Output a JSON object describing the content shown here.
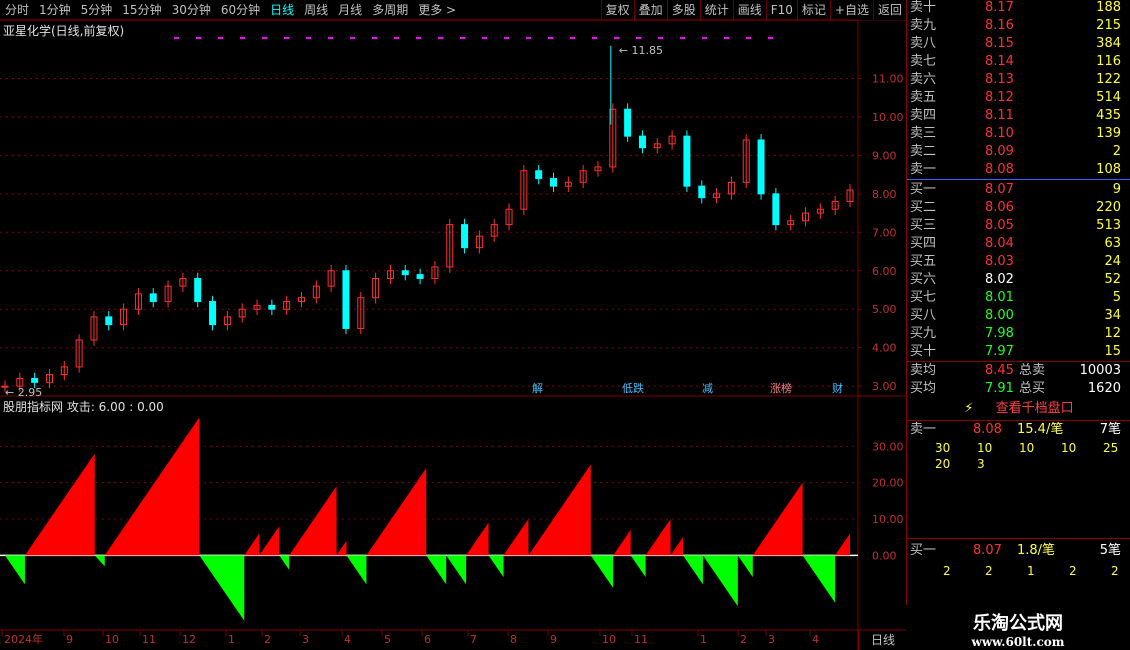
{
  "toolbar": {
    "periods": [
      "分时",
      "1分钟",
      "5分钟",
      "15分钟",
      "30分钟",
      "60分钟",
      "日线",
      "周线",
      "月线",
      "多周期",
      "更多 >"
    ],
    "active": "日线",
    "right": [
      "复权",
      "叠加",
      "多股",
      "统计",
      "画线",
      "F10",
      "标记",
      "+自选",
      "返回"
    ]
  },
  "main_title": "亚星化学(日线,前复权)",
  "sub_title": "股朋指标网  攻击: 6.00 : 0.00",
  "high_label": "11.85",
  "low_label": "2.95",
  "events": [
    "解",
    "低跌",
    "减",
    "涨榜",
    "财"
  ],
  "price_axis": [
    "11.00",
    "10.00",
    "9.00",
    "8.00",
    "7.00",
    "6.00",
    "5.00",
    "4.00",
    "3.00"
  ],
  "ind_axis": [
    "30.00",
    "20.00",
    "10.00",
    "0.00"
  ],
  "date_axis": [
    "2024年",
    "9",
    "10",
    "11",
    "12",
    "1",
    "2",
    "3",
    "4",
    "5",
    "6",
    "7",
    "8",
    "9",
    "10",
    "11",
    "1",
    "2",
    "3",
    "4"
  ],
  "period_label": "日线",
  "book": {
    "asks": [
      {
        "label": "卖十",
        "price": "8.17",
        "vol": "188"
      },
      {
        "label": "卖九",
        "price": "8.16",
        "vol": "215"
      },
      {
        "label": "卖八",
        "price": "8.15",
        "vol": "384"
      },
      {
        "label": "卖七",
        "price": "8.14",
        "vol": "116"
      },
      {
        "label": "卖六",
        "price": "8.13",
        "vol": "122"
      },
      {
        "label": "卖五",
        "price": "8.12",
        "vol": "514"
      },
      {
        "label": "卖四",
        "price": "8.11",
        "vol": "435"
      },
      {
        "label": "卖三",
        "price": "8.10",
        "vol": "139"
      },
      {
        "label": "卖二",
        "price": "8.09",
        "vol": "2"
      },
      {
        "label": "卖一",
        "price": "8.08",
        "vol": "108"
      }
    ],
    "bids": [
      {
        "label": "买一",
        "price": "8.07",
        "vol": "9"
      },
      {
        "label": "买二",
        "price": "8.06",
        "vol": "220"
      },
      {
        "label": "买三",
        "price": "8.05",
        "vol": "513"
      },
      {
        "label": "买四",
        "price": "8.04",
        "vol": "63"
      },
      {
        "label": "买五",
        "price": "8.03",
        "vol": "24"
      },
      {
        "label": "买六",
        "price": "8.02",
        "vol": "52"
      },
      {
        "label": "买七",
        "price": "8.01",
        "vol": "5"
      },
      {
        "label": "买八",
        "price": "8.00",
        "vol": "34"
      },
      {
        "label": "买九",
        "price": "7.98",
        "vol": "12"
      },
      {
        "label": "买十",
        "price": "7.97",
        "vol": "15"
      }
    ],
    "ask_avg_label": "卖均",
    "ask_avg": "8.45",
    "total_ask_label": "总卖",
    "total_ask": "10003",
    "bid_avg_label": "买均",
    "bid_avg": "7.91",
    "total_bid_label": "总买",
    "total_bid": "1620"
  },
  "queue": {
    "button": "查看千档盘口",
    "ask1_label": "卖一",
    "ask1_price": "8.08",
    "ask1_per": "15.4/笔",
    "ask1_count": "7笔",
    "ask1_orders": [
      "30",
      "10",
      "10",
      "10",
      "25",
      "20",
      "3"
    ],
    "bid1_label": "买一",
    "bid1_price": "8.07",
    "bid1_per": "1.8/笔",
    "bid1_count": "5笔",
    "bid1_orders": [
      "2",
      "2",
      "1",
      "2",
      "2"
    ]
  },
  "watermark": {
    "line1": "乐淘公式网",
    "line2": "www.60lt.com"
  },
  "colors": {
    "up": "#ff3030",
    "down": "#00ffff",
    "bar_pos": "#ff0000",
    "bar_neg": "#00ff00",
    "grid": "#800000"
  },
  "chart_data": [
    {
      "type": "candlestick",
      "title": "亚星化学(日线,前复权)",
      "x_range": [
        "2024-07",
        "2025-04"
      ],
      "ylim": [
        2.9,
        12.0
      ],
      "close_approx": [
        3.0,
        3.2,
        3.1,
        3.3,
        3.5,
        4.2,
        4.8,
        4.6,
        5.0,
        5.4,
        5.2,
        5.6,
        5.8,
        5.2,
        4.6,
        4.8,
        5.0,
        5.1,
        5.0,
        5.2,
        5.3,
        5.6,
        6.0,
        4.5,
        5.3,
        5.8,
        6.0,
        5.9,
        5.8,
        6.1,
        7.2,
        6.6,
        6.9,
        7.2,
        7.6,
        8.6,
        8.4,
        8.2,
        8.3,
        8.6,
        8.7,
        10.2,
        9.5,
        9.2,
        9.3,
        9.5,
        8.2,
        7.9,
        8.0,
        8.3,
        9.4,
        8.0,
        7.2,
        7.3,
        7.5,
        7.6,
        7.8,
        8.1
      ],
      "high": 11.85,
      "low": 2.95
    },
    {
      "type": "bar",
      "title": "股朋指标网  攻击: 6.00 : 0.00",
      "ylim": [
        -20,
        40
      ],
      "cycles": [
        {
          "start": 0,
          "peak": -8,
          "end": 0
        },
        {
          "start": 0,
          "peak": 28,
          "end": 0
        },
        {
          "start": 0,
          "peak": -3,
          "end": 0
        },
        {
          "start": 0,
          "peak": 38,
          "end": 0
        },
        {
          "start": 0,
          "peak": -18,
          "end": 0
        },
        {
          "start": 0,
          "peak": 6,
          "end": 0
        },
        {
          "start": 0,
          "peak": 8,
          "end": 0
        },
        {
          "start": 0,
          "peak": -4,
          "end": 0
        },
        {
          "start": 0,
          "peak": 19,
          "end": 0
        },
        {
          "start": 0,
          "peak": 4,
          "end": 0
        },
        {
          "start": 0,
          "peak": -8,
          "end": 0
        },
        {
          "start": 0,
          "peak": 24,
          "end": 0
        },
        {
          "start": 0,
          "peak": -8,
          "end": 0
        },
        {
          "start": 0,
          "peak": -8,
          "end": 0
        },
        {
          "start": 0,
          "peak": 9,
          "end": 0
        },
        {
          "start": 0,
          "peak": -6,
          "end": 0
        },
        {
          "start": 0,
          "peak": 10,
          "end": 0
        },
        {
          "start": 0,
          "peak": 25,
          "end": 0
        },
        {
          "start": 0,
          "peak": -9,
          "end": 0
        },
        {
          "start": 0,
          "peak": 7,
          "end": 0
        },
        {
          "start": 0,
          "peak": -6,
          "end": 0
        },
        {
          "start": 0,
          "peak": 10,
          "end": 0
        },
        {
          "start": 0,
          "peak": 5,
          "end": 0
        },
        {
          "start": 0,
          "peak": -8,
          "end": 0
        },
        {
          "start": 0,
          "peak": -14,
          "end": 0
        },
        {
          "start": 0,
          "peak": -6,
          "end": 0
        },
        {
          "start": 0,
          "peak": 20,
          "end": 0
        },
        {
          "start": 0,
          "peak": -13,
          "end": 0
        },
        {
          "start": 0,
          "peak": 6,
          "end": 0
        }
      ]
    }
  ]
}
